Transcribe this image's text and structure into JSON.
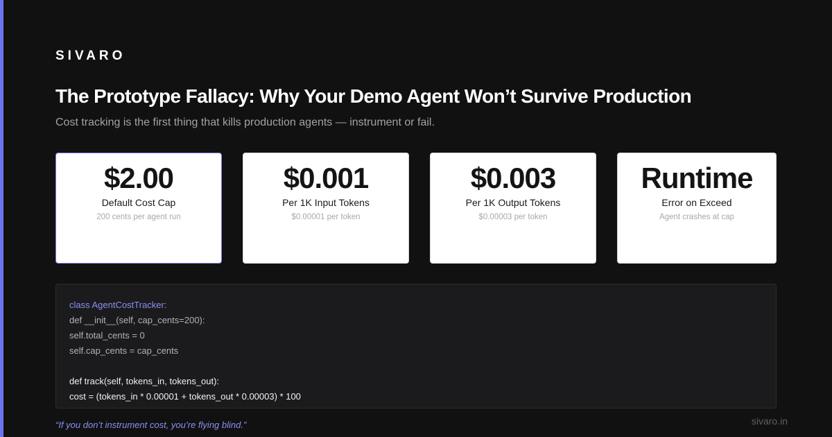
{
  "brand": "SIVARO",
  "title": "The Prototype Fallacy: Why Your Demo Agent Won’t Survive Production",
  "subtitle": "Cost tracking is the first thing that kills production agents — instrument or fail.",
  "cards": [
    {
      "value": "$2.00",
      "label": "Default Cost Cap",
      "sub": "200 cents per agent run"
    },
    {
      "value": "$0.001",
      "label": "Per 1K Input Tokens",
      "sub": "$0.00001 per token"
    },
    {
      "value": "$0.003",
      "label": "Per 1K Output Tokens",
      "sub": "$0.00003 per token"
    },
    {
      "value": "Runtime",
      "label": "Error on Exceed",
      "sub": "Agent crashes at cap"
    }
  ],
  "code": [
    "class AgentCostTracker:",
    "def __init__(self, cap_cents=200):",
    "self.total_cents = 0",
    "self.cap_cents = cap_cents",
    "def track(self, tokens_in, tokens_out):",
    "cost = (tokens_in * 0.00001 + tokens_out * 0.00003) * 100"
  ],
  "quote": "“If you don’t instrument cost, you’re flying blind.”",
  "site_url": "sivaro.in",
  "colors": {
    "background": "#111111",
    "accent": "#6b73f0",
    "card_background": "#ffffff",
    "code_background": "#1b1b1d"
  }
}
